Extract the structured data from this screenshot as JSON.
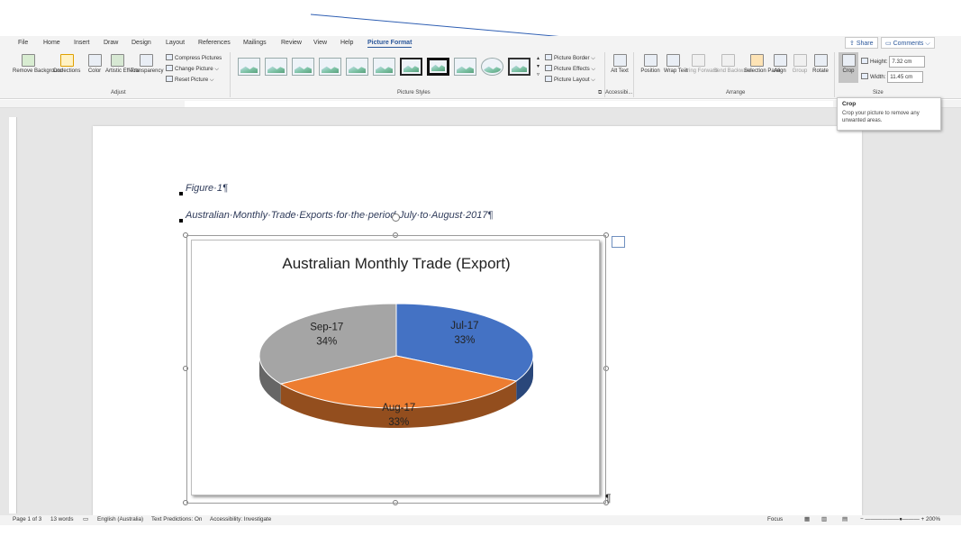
{
  "tabs": [
    "File",
    "Home",
    "Insert",
    "Draw",
    "Design",
    "Layout",
    "References",
    "Mailings",
    "Review",
    "View",
    "Help",
    "Picture Format"
  ],
  "active_tab": "Picture Format",
  "share_label": "Share",
  "comments_label": "Comments",
  "ribbon": {
    "adjust": {
      "label": "Adjust",
      "remove_bg": "Remove Background",
      "corrections": "Corrections",
      "color": "Color",
      "artistic": "Artistic Effects",
      "transparency": "Transparency",
      "compress": "Compress Pictures",
      "change": "Change Picture",
      "reset": "Reset Picture"
    },
    "picture_styles": {
      "label": "Picture Styles",
      "border": "Picture Border",
      "effects": "Picture Effects",
      "layout": "Picture Layout"
    },
    "accessibility": {
      "label": "Accessibi...",
      "alt_text": "Alt Text"
    },
    "arrange": {
      "label": "Arrange",
      "position": "Position",
      "wrap": "Wrap Text",
      "bring": "Bring Forward",
      "send": "Send Backward",
      "selection": "Selection Pane",
      "align": "Align",
      "group": "Group",
      "rotate": "Rotate"
    },
    "size": {
      "label": "Size",
      "crop": "Crop",
      "height_label": "Height:",
      "height_value": "7.32 cm",
      "width_label": "Width:",
      "width_value": "11.45 cm"
    }
  },
  "tooltip": {
    "title": "Crop",
    "text": "Crop your picture to remove any unwanted areas."
  },
  "document": {
    "figure": "Figure·1¶",
    "caption": "Australian·Monthly·Trade·Exports·for·the·period·July·to·August·2017¶",
    "pilcrow": "¶"
  },
  "chart_data": {
    "type": "pie",
    "title": "Australian Monthly Trade (Export)",
    "slices": [
      {
        "label": "Jul-17",
        "pct_label": "33%",
        "value": 33,
        "color": "#4472c4"
      },
      {
        "label": "Aug-17",
        "pct_label": "33%",
        "value": 33,
        "color": "#ed7d31"
      },
      {
        "label": "Sep-17",
        "pct_label": "34%",
        "value": 34,
        "color": "#a5a5a5"
      }
    ]
  },
  "status": {
    "page": "Page 1 of 3",
    "words": "13 words",
    "language": "English (Australia)",
    "predictions": "Text Predictions: On",
    "accessibility": "Accessibility: Investigate",
    "focus": "Focus",
    "zoom": "200%"
  }
}
